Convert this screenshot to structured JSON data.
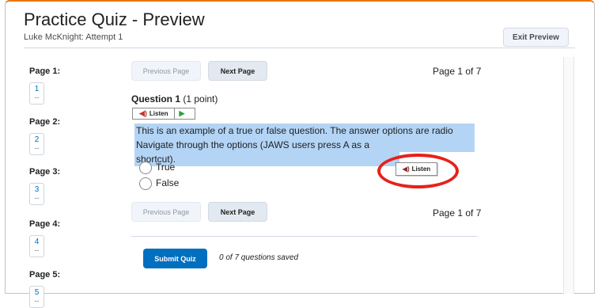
{
  "header": {
    "title": "Practice Quiz - Preview",
    "subtitle": "Luke McKnight: Attempt 1",
    "exit_label": "Exit Preview"
  },
  "sidebar": {
    "pages": [
      {
        "label": "Page 1:",
        "number": "1",
        "status": "--"
      },
      {
        "label": "Page 2:",
        "number": "2",
        "status": "--"
      },
      {
        "label": "Page 3:",
        "number": "3",
        "status": "--"
      },
      {
        "label": "Page 4:",
        "number": "4",
        "status": "--"
      },
      {
        "label": "Page 5:",
        "number": "5",
        "status": "--"
      }
    ]
  },
  "nav": {
    "prev_label": "Previous Page",
    "next_label": "Next Page",
    "page_indicator": "Page 1 of 7"
  },
  "question": {
    "title": "Question 1",
    "points": "(1 point)",
    "listen_label": "Listen",
    "text_line1": "This is an example of a true or false question. The answer options are radio buttons.",
    "text_line2": "Navigate through the options (JAWS users press A as a shortcut).",
    "options": [
      "True",
      "False"
    ],
    "listen_popup_label": "Listen"
  },
  "footer": {
    "submit_label": "Submit Quiz",
    "saved_status": "0 of 7 questions saved"
  },
  "colors": {
    "accent_top": "#e87511",
    "primary": "#006fbf",
    "highlight": "#b3d4f5",
    "annotation": "#e8201a"
  }
}
